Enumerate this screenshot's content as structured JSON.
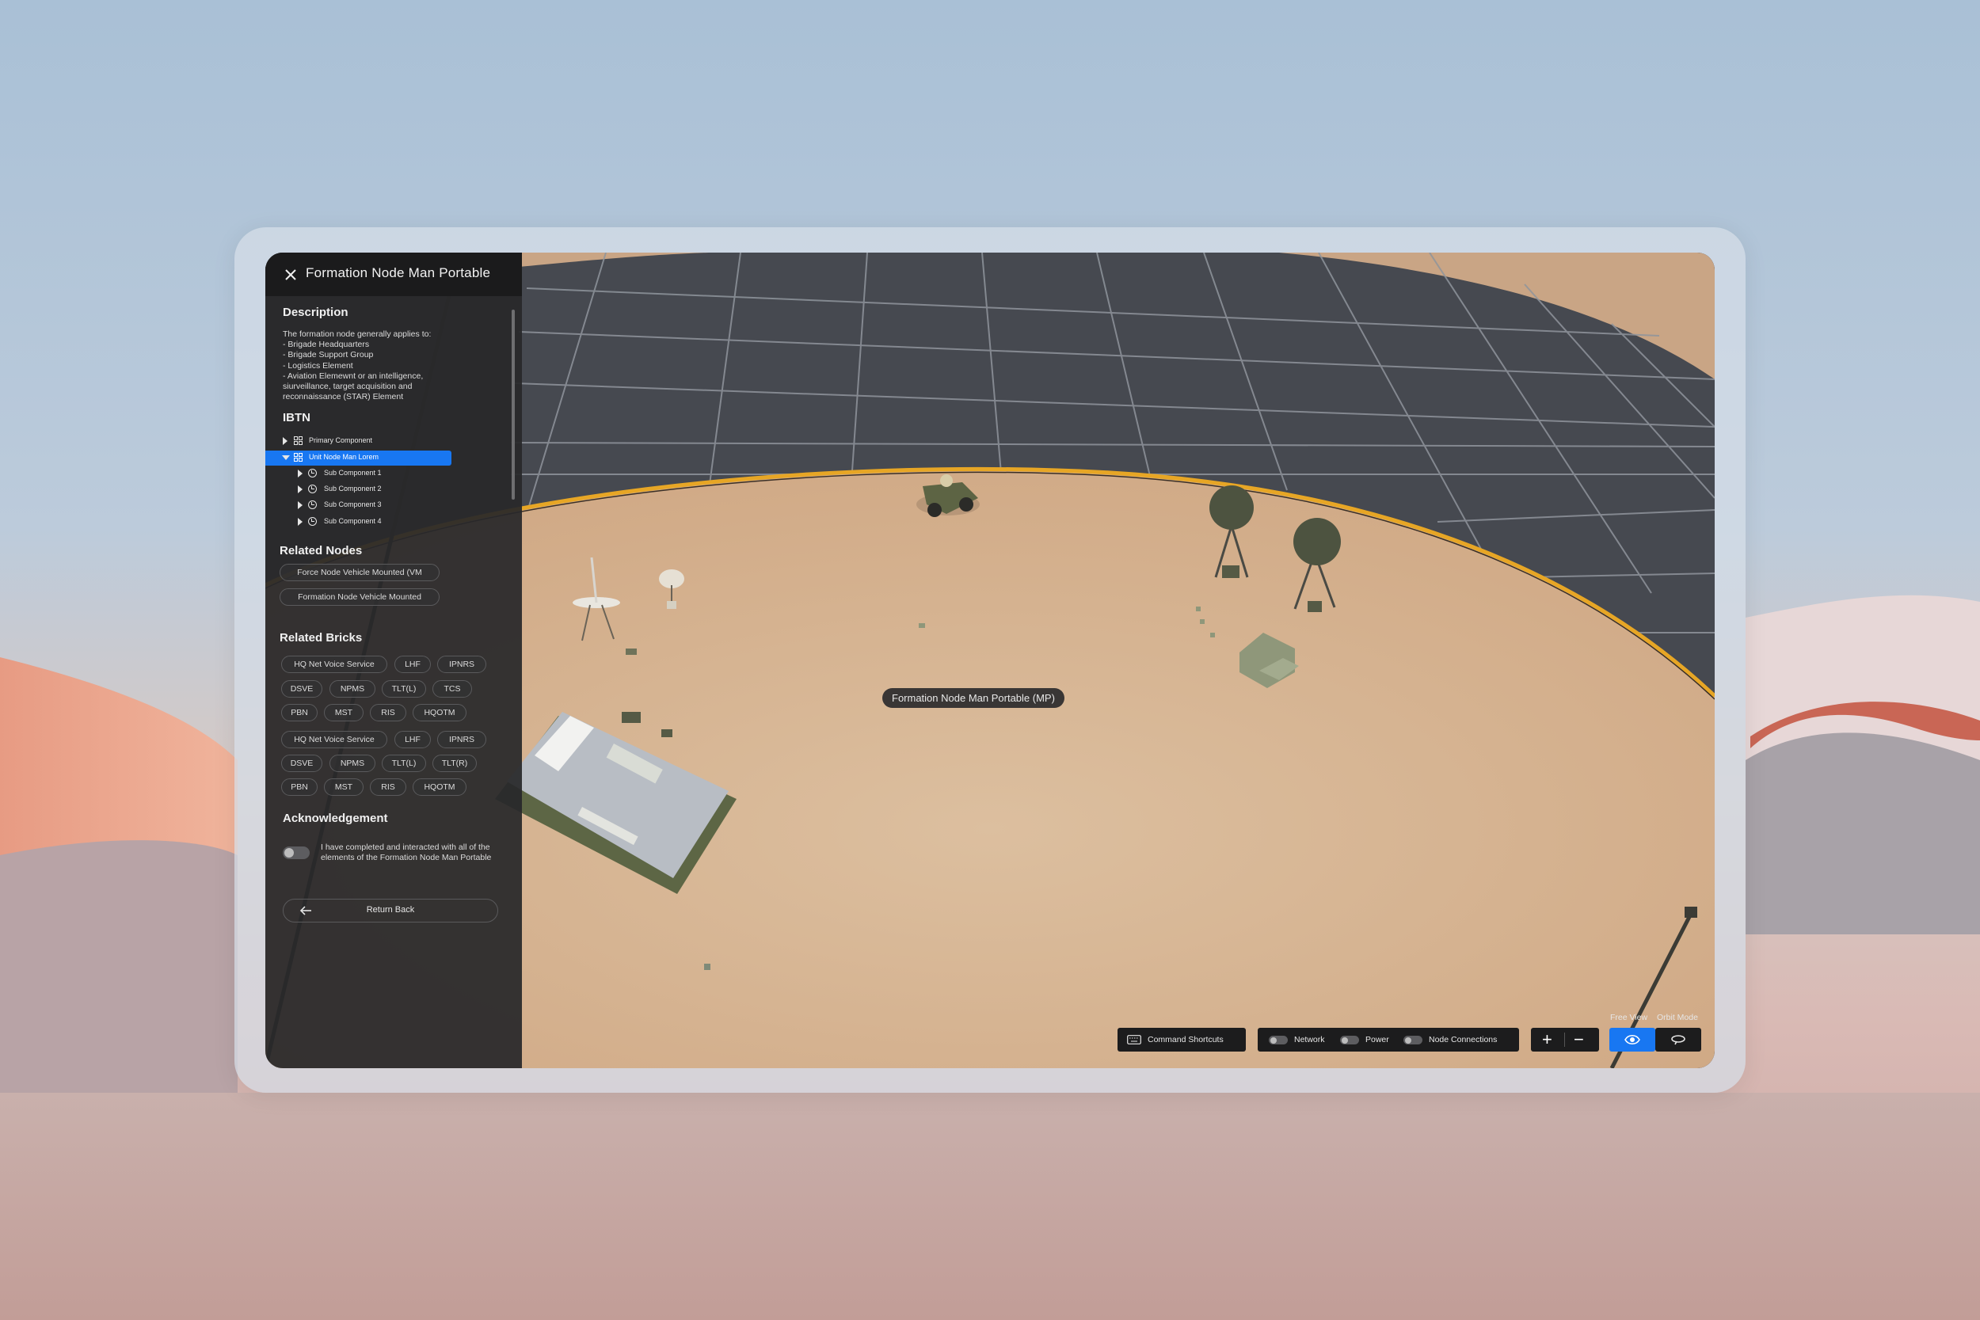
{
  "panel": {
    "title": "Formation Node Man Portable",
    "description": {
      "heading": "Description",
      "lines": [
        "The formation node generally applies to:",
        "- Brigade Headquarters",
        "- Brigade Support Group",
        "- Logistics Element",
        "- Aviation Elemewnt or an intelligence,",
        "siurveillance, target acquisition and",
        "reconnaissance (STAR) Element"
      ]
    },
    "ibtn": {
      "heading": "IBTN",
      "items": [
        {
          "label": "Primary Component",
          "expanded": false,
          "selected": false
        },
        {
          "label": "Unit Node Man Lorem",
          "expanded": true,
          "selected": true
        },
        {
          "label": "Sub Component 1"
        },
        {
          "label": "Sub Component 2"
        },
        {
          "label": "Sub Component 3"
        },
        {
          "label": "Sub Component 4"
        }
      ]
    },
    "related_nodes": {
      "heading": "Related Nodes",
      "items": [
        "Force Node Vehicle Mounted (VM",
        "Formation Node Vehicle Mounted"
      ]
    },
    "related_bricks": {
      "heading": "Related Bricks",
      "items": [
        "HQ Net Voice Service",
        "LHF",
        "IPNRS",
        "DSVE",
        "NPMS",
        "TLT(L)",
        "TCS",
        "PBN",
        "MST",
        "RIS",
        "HQOTM",
        "HQ Net Voice Service",
        "LHF",
        "IPNRS",
        "DSVE",
        "NPMS",
        "TLT(L)",
        "TLT(R)",
        "PBN",
        "MST",
        "RIS",
        "HQOTM"
      ]
    },
    "acknowledgement": {
      "heading": "Acknowledgement",
      "text": "I have completed and interacted with all of the elements of the Formation Node Man Portable",
      "checked": false
    },
    "return_button": "Return Back"
  },
  "scene": {
    "tooltip": "Formation Node Man Portable (MP)"
  },
  "toolbar": {
    "command_shortcuts": "Command Shortcuts",
    "layers": [
      {
        "label": "Network",
        "on": false
      },
      {
        "label": "Power",
        "on": false
      },
      {
        "label": "Node Connections",
        "on": false
      }
    ],
    "zoom_in": "+",
    "zoom_out": "−",
    "view_modes": {
      "free_view": "Free View",
      "orbit_mode": "Orbit Mode",
      "active": "free_view"
    }
  },
  "colors": {
    "accent": "#1877f2",
    "ring": "#e7a625",
    "sand": "#d8b592"
  }
}
